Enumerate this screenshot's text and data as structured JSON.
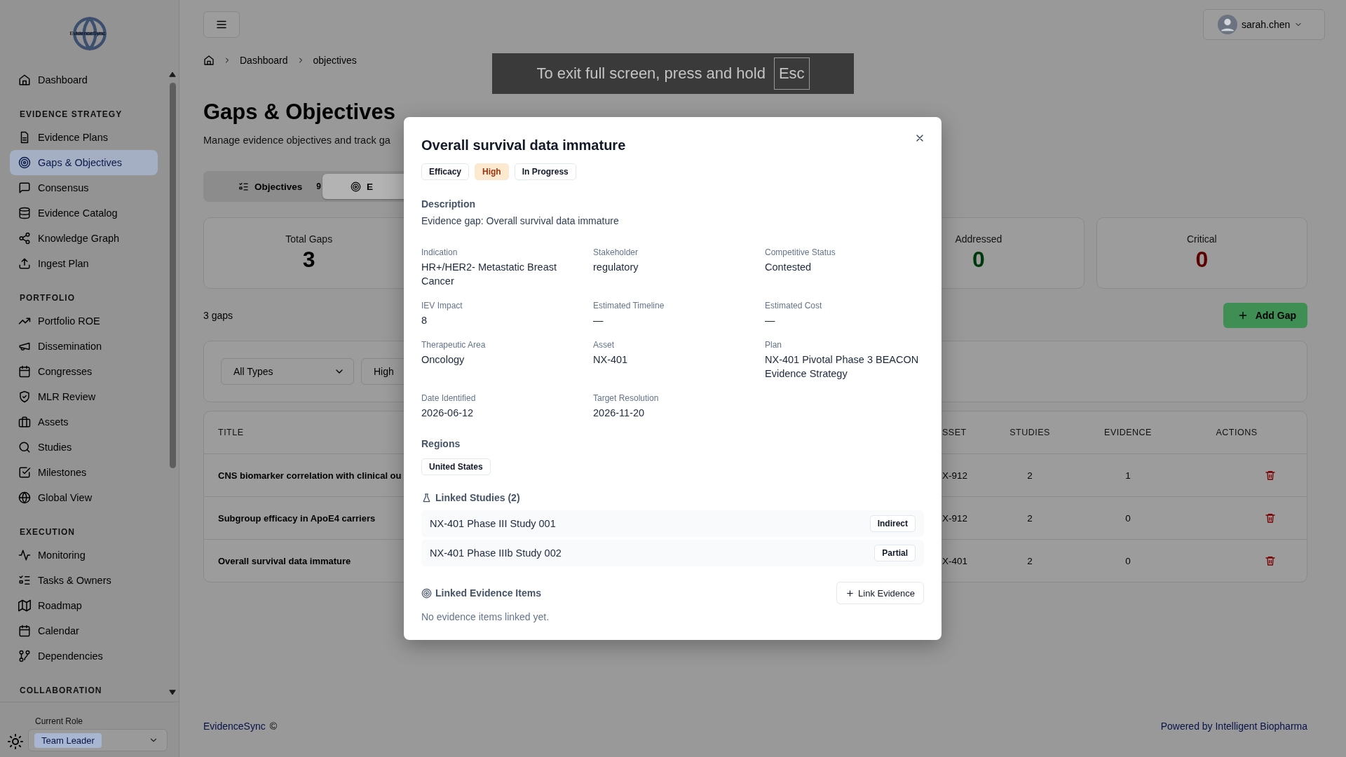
{
  "sidebar": {
    "logo": "EvidenceSync",
    "sections": [
      {
        "items": [
          {
            "label": "Dashboard",
            "selected": false
          }
        ]
      },
      {
        "header": "EVIDENCE STRATEGY",
        "items": [
          {
            "label": "Evidence Plans",
            "selected": false
          },
          {
            "label": "Gaps & Objectives",
            "selected": true
          },
          {
            "label": "Consensus",
            "selected": false
          },
          {
            "label": "Evidence Catalog",
            "selected": false
          },
          {
            "label": "Knowledge Graph",
            "selected": false
          },
          {
            "label": "Ingest Plan",
            "selected": false
          }
        ]
      },
      {
        "header": "PORTFOLIO",
        "items": [
          {
            "label": "Portfolio ROE",
            "selected": false
          },
          {
            "label": "Dissemination",
            "selected": false
          },
          {
            "label": "Congresses",
            "selected": false
          },
          {
            "label": "MLR Review",
            "selected": false
          },
          {
            "label": "Assets",
            "selected": false
          },
          {
            "label": "Studies",
            "selected": false
          },
          {
            "label": "Milestones",
            "selected": false
          },
          {
            "label": "Global View",
            "selected": false
          }
        ]
      },
      {
        "header": "EXECUTION",
        "items": [
          {
            "label": "Monitoring",
            "selected": false
          },
          {
            "label": "Tasks & Owners",
            "selected": false
          },
          {
            "label": "Roadmap",
            "selected": false
          },
          {
            "label": "Calendar",
            "selected": false
          },
          {
            "label": "Dependencies",
            "selected": false
          }
        ]
      },
      {
        "header": "COLLABORATION"
      }
    ],
    "role": {
      "label": "Current Role",
      "value": "Team Leader"
    }
  },
  "header": {
    "user": "sarah.chen"
  },
  "breadcrumb": [
    "Dashboard",
    "objectives"
  ],
  "fullscreen_notice": {
    "text": "To exit full screen, press and hold",
    "key": "Esc"
  },
  "page": {
    "title": "Gaps & Objectives",
    "subtitle": "Manage evidence objectives and track ga",
    "tabs": [
      {
        "label": "Objectives",
        "count": "9",
        "selected": false
      },
      {
        "label": "E",
        "selected": true
      }
    ],
    "stats": [
      {
        "label": "Total Gaps",
        "value": "3",
        "color": "#000000"
      },
      {
        "label": "Addressed",
        "value": "0",
        "color": "#00380e"
      },
      {
        "label": "Critical",
        "value": "0",
        "color": "#5c0000"
      }
    ],
    "count": "3 gaps",
    "add_button": "Add Gap",
    "filters": [
      "All Types",
      "High"
    ],
    "table": {
      "columns": [
        "TITLE",
        "SSET",
        "STUDIES",
        "EVIDENCE",
        "ACTIONS"
      ],
      "rows": [
        {
          "title": "CNS biomarker correlation with clinical ou",
          "column_2": "X-912",
          "studies": "2",
          "evidence": "1"
        },
        {
          "title": "Subgroup efficacy in ApoE4 carriers",
          "column_2": "X-912",
          "studies": "2",
          "evidence": "0"
        },
        {
          "title": "Overall survival data immature",
          "column_2": "X-401",
          "studies": "2",
          "evidence": "0"
        }
      ]
    }
  },
  "footer": {
    "brand": "EvidenceSync",
    "mark": "©",
    "powered": "Powered by Intelligent Biopharma"
  },
  "modal": {
    "title": "Overall survival data immature",
    "tags": [
      {
        "label": "Efficacy",
        "kind": "plain"
      },
      {
        "label": "High",
        "kind": "priority"
      },
      {
        "label": "In Progress",
        "kind": "plain"
      }
    ],
    "description": {
      "heading": "Description",
      "text": "Evidence gap: Overall survival data immature"
    },
    "fields": [
      {
        "label": "Indication",
        "value": "HR+/HER2- Metastatic Breast Cancer"
      },
      {
        "label": "Stakeholder",
        "value": "regulatory"
      },
      {
        "label": "Competitive Status",
        "value": "Contested"
      },
      {
        "label": "IEV Impact",
        "value": "8"
      },
      {
        "label": "Estimated Timeline",
        "value": "—"
      },
      {
        "label": "Estimated Cost",
        "value": "—"
      },
      {
        "label": "Therapeutic Area",
        "value": "Oncology"
      },
      {
        "label": "Asset",
        "value": "NX-401"
      },
      {
        "label": "Plan",
        "value": "NX-401 Pivotal Phase 3 BEACON Evidence Strategy"
      },
      {
        "label": "Date Identified",
        "value": "2026-06-12"
      },
      {
        "label": "Target Resolution",
        "value": "2026-11-20"
      }
    ],
    "regions": {
      "heading": "Regions",
      "items": [
        "United States"
      ]
    },
    "linked_studies": {
      "heading": "Linked Studies (2)",
      "items": [
        {
          "name": "NX-401 Phase III Study 001",
          "relation": "Indirect"
        },
        {
          "name": "NX-401 Phase IIIb Study 002",
          "relation": "Partial"
        }
      ]
    },
    "linked_evidence": {
      "heading": "Linked Evidence Items",
      "button": "Link Evidence",
      "empty": "No evidence items linked yet."
    }
  }
}
